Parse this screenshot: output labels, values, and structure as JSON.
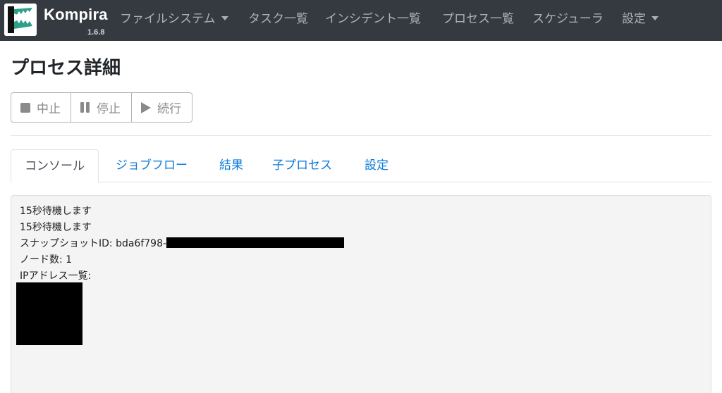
{
  "navbar": {
    "brand": "Kompira",
    "version": "1.6.8",
    "items": [
      {
        "label": "ファイルシステム",
        "dropdown": true
      },
      {
        "label": "タスク一覧",
        "dropdown": false
      },
      {
        "label": "インシデント一覧",
        "dropdown": false
      },
      {
        "label": "プロセス一覧",
        "dropdown": false
      },
      {
        "label": "スケジューラ",
        "dropdown": false
      },
      {
        "label": "設定",
        "dropdown": true
      }
    ]
  },
  "page": {
    "title": "プロセス詳細"
  },
  "toolbar": {
    "abort_label": "中止",
    "pause_label": "停止",
    "resume_label": "続行"
  },
  "tabs": [
    {
      "label": "コンソール",
      "active": true
    },
    {
      "label": "ジョブフロー",
      "active": false
    },
    {
      "label": "結果",
      "active": false
    },
    {
      "label": "子プロセス",
      "active": false
    },
    {
      "label": "設定",
      "active": false
    }
  ],
  "console": {
    "lines": [
      "15秒待機します",
      "15秒待機します",
      "スナップショットID: bda6f798-",
      "ノード数: 1",
      "IPアドレス一覧:"
    ]
  },
  "colors": {
    "navbar_bg": "#343a40",
    "tab_link": "#0d7bd8",
    "console_bg": "#f4f4f4"
  }
}
